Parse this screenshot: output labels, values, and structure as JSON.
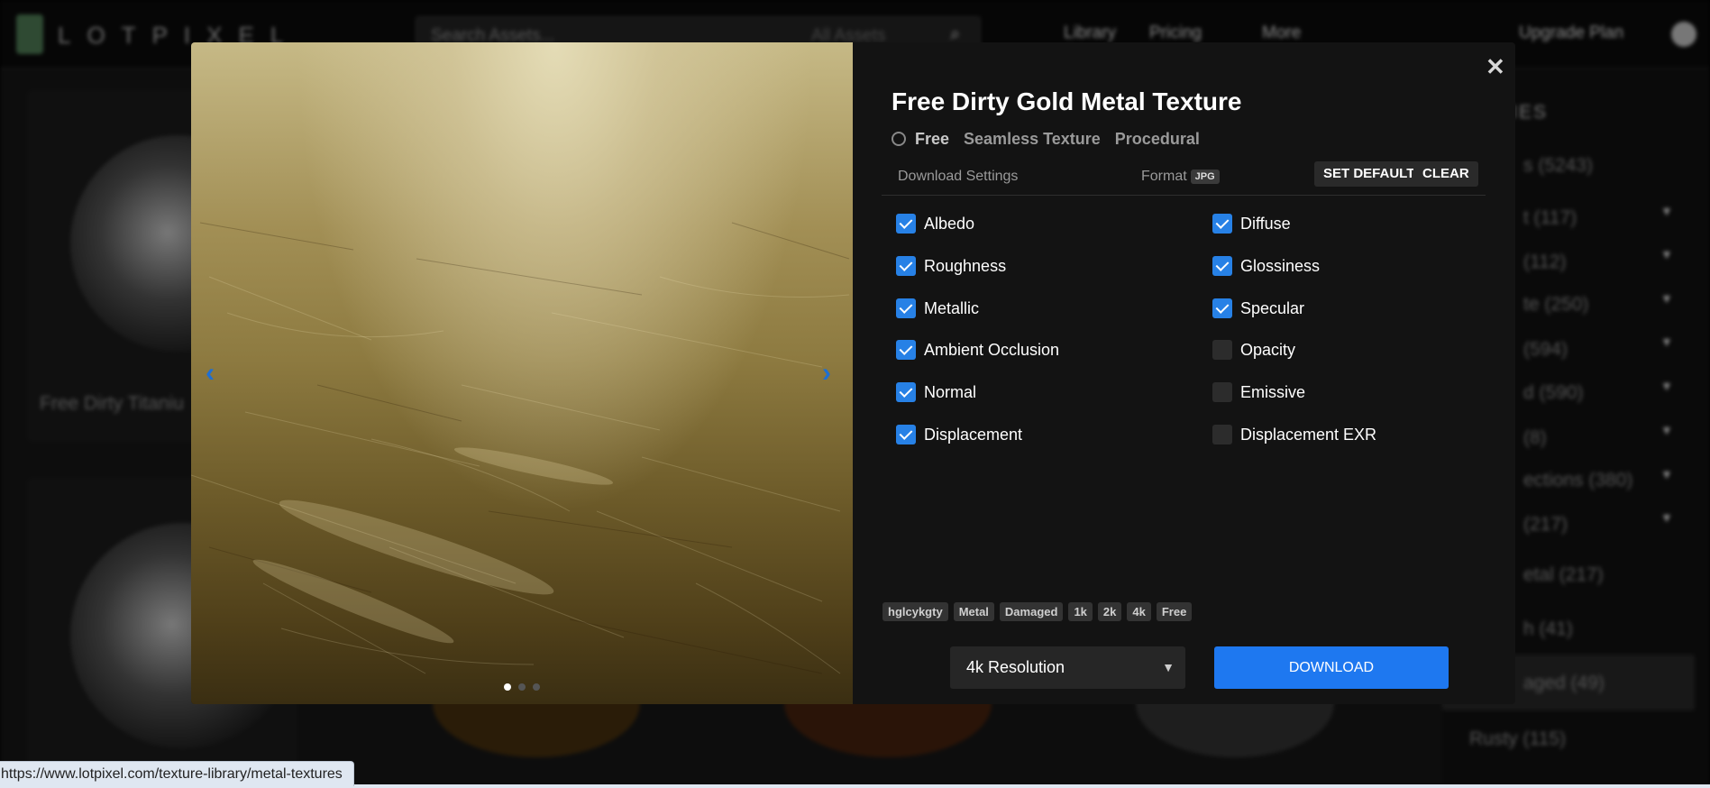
{
  "background": {
    "logo_text": "LOTPIXEL",
    "search_placeholder": "Search Assets...",
    "search_scope": "All Assets",
    "nav": [
      "Library",
      "Pricing",
      "More"
    ],
    "upgrade": "Upgrade Plan",
    "card_title": "Free Dirty Titaniu",
    "sidebar_title": "RIES",
    "sidebar_items": [
      {
        "label": "s (5243)"
      },
      {
        "label": "t (117)"
      },
      {
        "label": "(112)"
      },
      {
        "label": "te (250)"
      },
      {
        "label": "(594)"
      },
      {
        "label": "d (590)"
      },
      {
        "label": "(8)"
      },
      {
        "label": "ections (380)"
      },
      {
        "label": "(217)"
      },
      {
        "label": "etal (217)"
      },
      {
        "label": "h (41)"
      },
      {
        "label": "aged (49)"
      },
      {
        "label": "Rusty (115)"
      }
    ]
  },
  "modal": {
    "title": "Free Dirty Gold Metal Texture",
    "meta": {
      "free": "Free",
      "seamless": "Seamless Texture",
      "procedural": "Procedural"
    },
    "download_settings_label": "Download Settings",
    "format_label": "Format",
    "format_value": "JPG",
    "set_default_label": "SET DEFAULT",
    "clear_label": "CLEAR",
    "maps_left": [
      {
        "label": "Albedo",
        "checked": true
      },
      {
        "label": "Roughness",
        "checked": true
      },
      {
        "label": "Metallic",
        "checked": true
      },
      {
        "label": "Ambient Occlusion",
        "checked": true
      },
      {
        "label": "Normal",
        "checked": true
      },
      {
        "label": "Displacement",
        "checked": true
      }
    ],
    "maps_right": [
      {
        "label": "Diffuse",
        "checked": true
      },
      {
        "label": "Glossiness",
        "checked": true
      },
      {
        "label": "Specular",
        "checked": true
      },
      {
        "label": "Opacity",
        "checked": false
      },
      {
        "label": "Emissive",
        "checked": false
      },
      {
        "label": "Displacement EXR",
        "checked": false
      }
    ],
    "tags": [
      "hglcykgty",
      "Metal",
      "Damaged",
      "1k",
      "2k",
      "4k",
      "Free"
    ],
    "resolution": "4k Resolution",
    "download_label": "DOWNLOAD",
    "close_glyph": "✕",
    "prev_glyph": "‹",
    "next_glyph": "›",
    "slides": 3,
    "active_slide": 1
  },
  "status_url": "https://www.lotpixel.com/texture-library/metal-textures"
}
